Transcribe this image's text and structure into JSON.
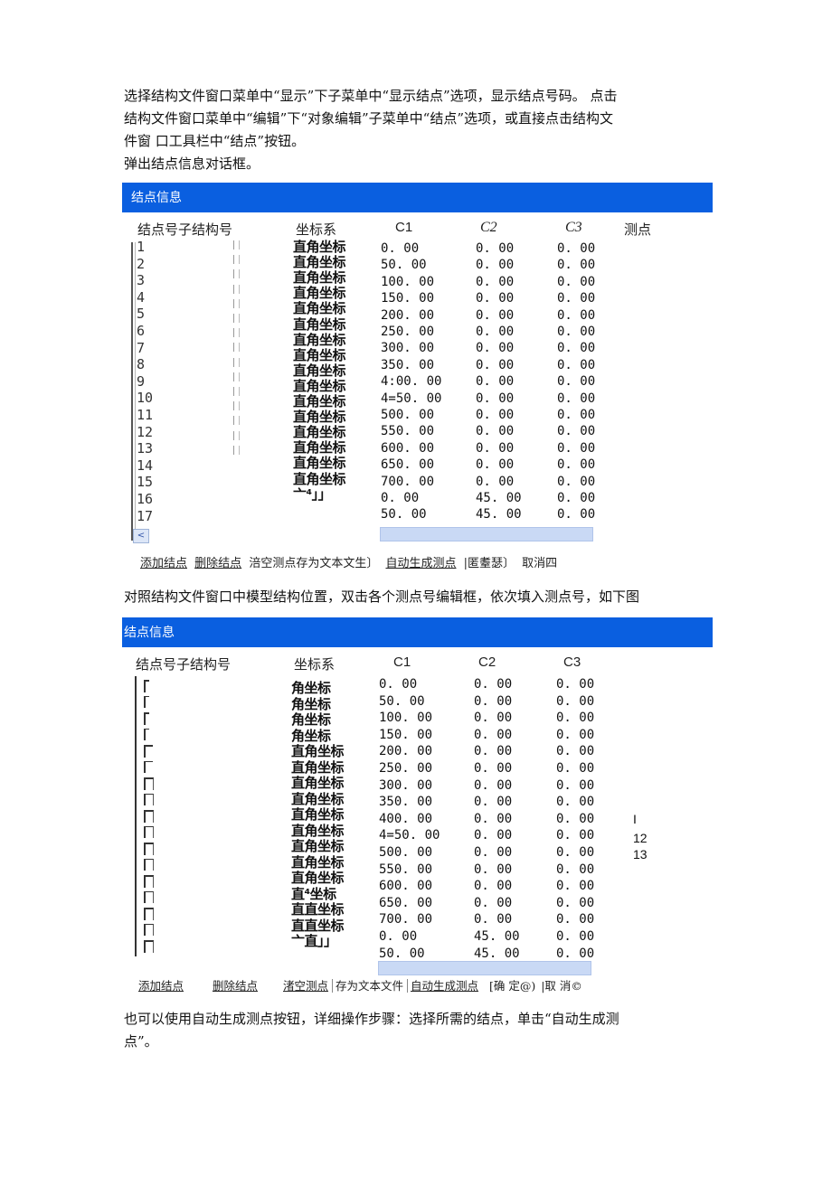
{
  "intro": {
    "lines": [
      "选择结构文件窗口菜单中“显示”下子菜单中“显示结点”选项，显示结点号码。 点击",
      "结构文件窗口菜单中“编辑”下“对象编辑”子菜单中“结点”选项，或直接点击结构文",
      "件窗  口工具栏中“结点”按钮。",
      "弹出结点信息对话框。"
    ]
  },
  "dialog1": {
    "title": "结点信息",
    "headers": {
      "node": "结点号子结构号",
      "coord": "坐标系",
      "c1": "C1",
      "c2": "C2",
      "c3": "C3",
      "measure": "测点"
    },
    "indices": [
      "1",
      "2",
      "3",
      "4",
      "5",
      "6",
      "7",
      "8",
      "9",
      "10",
      "11",
      "12",
      "13",
      "14",
      "15",
      "16",
      "17"
    ],
    "coords": [
      "直角坐标",
      "直角坐标",
      "直角坐标",
      "直角坐标",
      "直角坐标",
      "直角坐标",
      "直角坐标",
      "直角坐标",
      "直角坐标",
      "直角坐标",
      "直角坐标",
      "直角坐标",
      "直角坐标",
      "直角坐标",
      "直角坐标",
      "直角坐标",
      "亠⁴」」"
    ],
    "c1": [
      "0. 00",
      "50. 00",
      "100. 00",
      "150. 00",
      "200. 00",
      "250. 00",
      "300. 00",
      "350. 00",
      "4:00. 00",
      "4=50. 00",
      "500. 00",
      "550. 00",
      "600. 00",
      "650. 00",
      "700. 00",
      "0. 00",
      "50. 00"
    ],
    "c2": [
      "0. 00",
      "0. 00",
      "0. 00",
      "0. 00",
      "0. 00",
      "0. 00",
      "0. 00",
      "0. 00",
      "0. 00",
      "0. 00",
      "0. 00",
      "0. 00",
      "0. 00",
      "0. 00",
      "0. 00",
      "45. 00",
      "45. 00"
    ],
    "c3": [
      "0. 00",
      "0. 00",
      "0. 00",
      "0. 00",
      "0. 00",
      "0. 00",
      "0. 00",
      "0. 00",
      "0. 00",
      "0. 00",
      "0. 00",
      "0. 00",
      "0. 00",
      "0. 00",
      "0. 00",
      "0. 00",
      "0. 00"
    ],
    "scroll_left": "<",
    "buttons": {
      "add": "添加结点",
      "delete": "删除结点",
      "clear_save": "涪空测点存为文本文生〕",
      "auto": "自动生成测点",
      "confirm": "|匿耋瑟〕",
      "cancel": "取消四"
    }
  },
  "middle_text": "对照结构文件窗口中模型结构位置，双击各个测点号编辑框，依次填入测点号，如下图",
  "dialog2": {
    "title": "结点信息",
    "headers": {
      "node": "结点号子结构号",
      "coord": "坐标系",
      "c1": "C1",
      "c2": "C2",
      "c3": "C3"
    },
    "coords": [
      "角坐标",
      "角坐标",
      "角坐标",
      "角坐标",
      "直角坐标",
      "直角坐标",
      "直角坐标",
      "直角坐标",
      "直角坐标",
      "直角坐标",
      "直角坐标",
      "直角坐标",
      "直角坐标",
      "直⁴坐标",
      "直直坐标",
      "直直坐标",
      "亠直」」"
    ],
    "c1": [
      "0. 00",
      "50. 00",
      "100. 00",
      "150. 00",
      "200. 00",
      "250. 00",
      "300. 00",
      "350. 00",
      "400. 00",
      "4=50. 00",
      "500. 00",
      "550. 00",
      "600. 00",
      "650. 00",
      "700. 00",
      "0. 00",
      "50. 00"
    ],
    "c2": [
      "0. 00",
      "0. 00",
      "0. 00",
      "0. 00",
      "0. 00",
      "0. 00",
      "0. 00",
      "0. 00",
      "0. 00",
      "0. 00",
      "0. 00",
      "0. 00",
      "0. 00",
      "0. 00",
      "0. 00",
      "45. 00",
      "45. 00"
    ],
    "c3": [
      "0. 00",
      "0. 00",
      "0. 00",
      "0. 00",
      "0. 00",
      "0. 00",
      "0. 00",
      "0. 00",
      "0. 00",
      "0. 00",
      "0. 00",
      "0. 00",
      "0. 00",
      "0. 00",
      "0. 00",
      "0. 00",
      "0. 00"
    ],
    "measure_points": [
      "I",
      "12",
      "13"
    ],
    "buttons": {
      "add": "添加结点",
      "delete": "删除结点",
      "clear": "渚空测点",
      "save_text": "存为文本文件",
      "auto": "自动生成测点",
      "confirm": "[确  定@)",
      "cancel": "|取  消©"
    }
  },
  "outro": {
    "lines": [
      "也可以使用自动生成测点按钮，详细操作步骤：选择所需的结点，单击“自动生成测",
      "点”。"
    ]
  },
  "colors": {
    "title_bar": "#0a5fe0",
    "scrollbar": "#c9d9f5"
  }
}
